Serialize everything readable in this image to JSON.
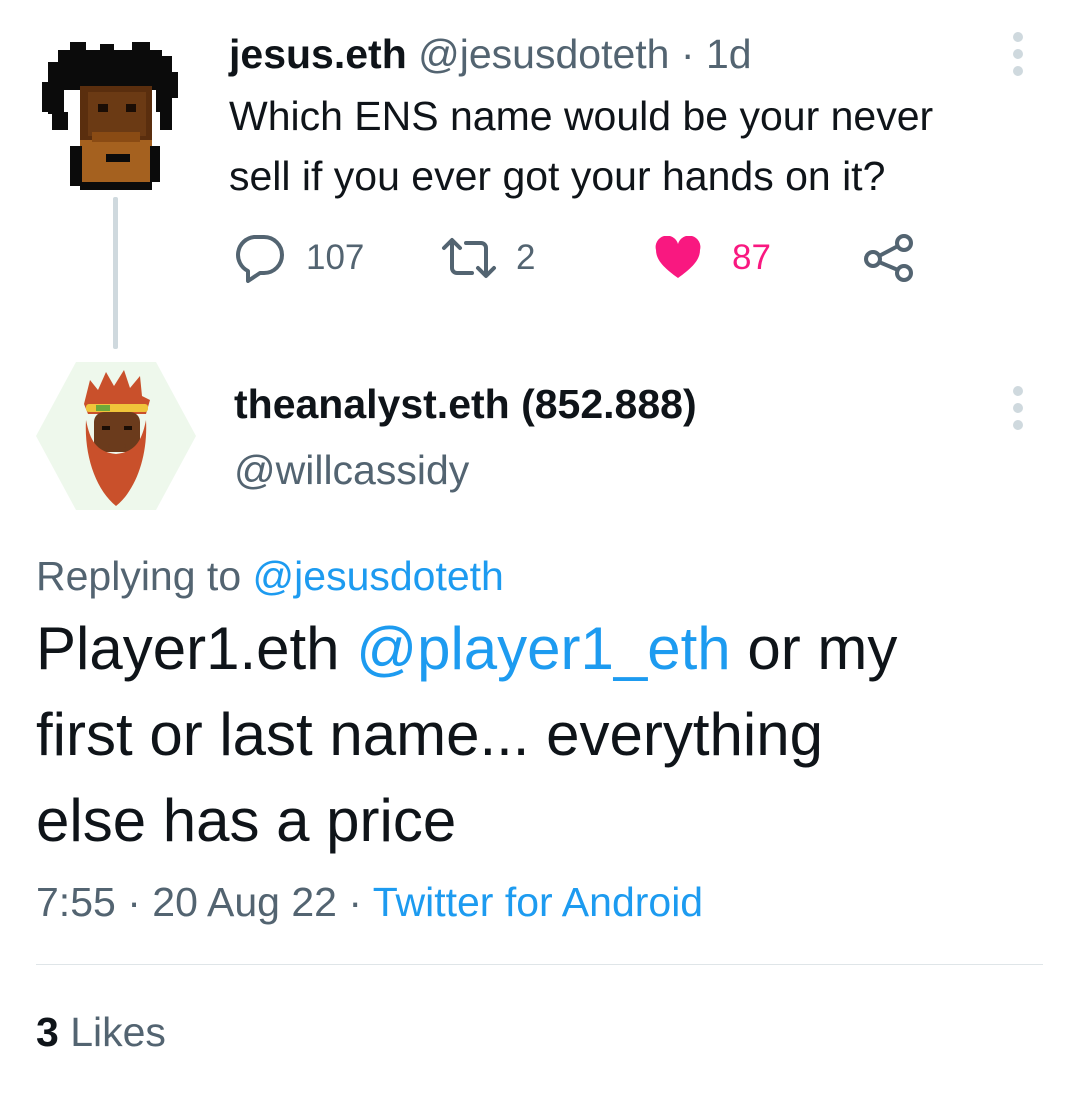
{
  "parent_tweet": {
    "display_name": "jesus.eth",
    "handle": "@jesusdoteth",
    "separator": "·",
    "time_ago": "1d",
    "text_line1": "Which ENS name would be your never",
    "text_line2": "sell if you ever got your hands on it?",
    "reply_count": "107",
    "retweet_count": "2",
    "like_count": "87",
    "liked": true,
    "avatar_icon": "pixel-art-avatar-icon",
    "colors": {
      "like_active": "#f91880",
      "muted": "#536471"
    }
  },
  "reply_tweet": {
    "display_name": "theanalyst.eth (852.888)",
    "handle": "@willcassidy",
    "replying_prefix": "Replying to",
    "replying_handle": "@jesusdoteth",
    "text_part1": "Player1.eth",
    "mention": "@player1_eth",
    "text_part2": "or my",
    "text_line2": "first or last name... everything",
    "text_line3": "else has a price",
    "time": "7:55",
    "date": "20 Aug 22",
    "separator": "·",
    "source": "Twitter for Android",
    "likes_count": "3",
    "likes_label": "Likes",
    "avatar_icon": "bearded-man-avatar-icon",
    "colors": {
      "link": "#1d9bf0",
      "text": "#0f1419"
    }
  }
}
